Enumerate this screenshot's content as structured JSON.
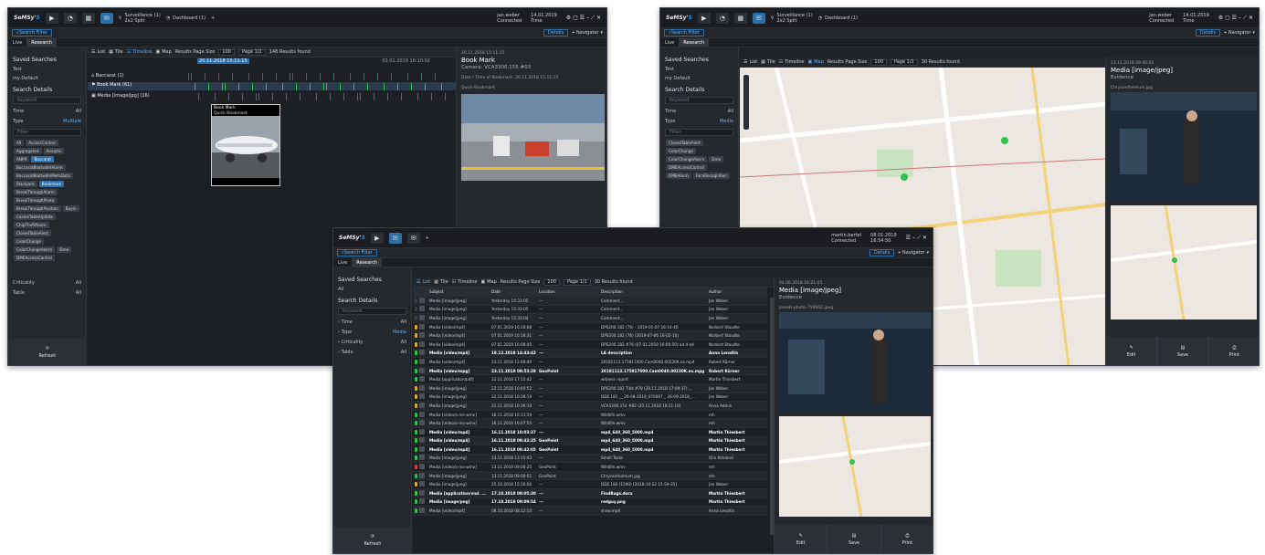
{
  "brand": {
    "name": "SeMSy",
    "suffix": "S"
  },
  "win1": {
    "tabs": [
      "Surveillance (1)",
      "2x2 Split",
      "Dashboard (1)"
    ],
    "user": "jan.weber",
    "status": "Connected",
    "date": "14.01.2019",
    "time": "Time",
    "search_filter": "Search Filter",
    "details": "Details",
    "navigator": "Navigator",
    "live": "Live",
    "research": "Research",
    "saved_searches": "Saved Searches",
    "saved": [
      "Test",
      "my Default"
    ],
    "search_details": "Search Details",
    "keyword": "Keyword",
    "time_val": "All",
    "type": "Type",
    "type_val": "Multiple",
    "filter": "Filter",
    "chips": [
      "All",
      "AccessControl",
      "Aggregated",
      "Analytic",
      "ANPR",
      "Baccarat",
      "BaccaratBlattwählAlarm",
      "BaccaratBlattwählMetaData",
      "Blackjack",
      "Bookmark",
      "BreakThroughAlarm",
      "BreakThroughPhoto",
      "BreakThroughPosition",
      "Buyin",
      "CasinoTableUpdate",
      "ChipTheftAlarm",
      "ClosedTableAlert",
      "ColorChange",
      "ColorChangeAlarm",
      "Dme",
      "DMEAccessControl"
    ],
    "criticality": "Criticality",
    "crit_val": "All",
    "table": "Table",
    "table_val": "All",
    "refresh": "Refresh",
    "toolbar": {
      "list": "List",
      "tile": "Tile",
      "timeline": "Timeline",
      "map": "Map",
      "page_size_lbl": "Results Page Size",
      "page_size": "100",
      "page": "Page 1/2",
      "results": "148 Results found"
    },
    "tl_date": "20.11.2018 15:11:15",
    "tl_right": "03.01.2019 16:10:02",
    "rows": [
      "Baccarat (1)",
      "Book Mark (61)",
      "Media [image/jpg] (16)"
    ],
    "popup": {
      "title": "Book Mark",
      "sub": "Quick Bookmark"
    },
    "detail": {
      "date": "20.11.2018 15:11:15",
      "title": "Book Mark",
      "sub": "Camera: VCA3300.155 #03",
      "line1": "Date / Time of Bookmark: 20.11.2018 15:11:15",
      "line2": "Quick Bookmark"
    }
  },
  "win2": {
    "tabs": [
      "Surveillance (1)",
      "2x2 Split",
      "Dashboard (1)"
    ],
    "user": "jan.weber",
    "status": "Connected",
    "date": "14.01.2019",
    "time": "Time",
    "search_filter": "Search Filter",
    "details": "Details",
    "navigator": "Navigator",
    "live": "Live",
    "research": "Research",
    "saved_searches": "Saved Searches",
    "saved": [
      "Test",
      "my Default"
    ],
    "search_details": "Search Details",
    "keyword": "Keyword",
    "time_val": "All",
    "type": "Type",
    "type_val": "Media",
    "filter": "Filter",
    "chips": [
      "ClosedTableAlert",
      "ColorChange",
      "ColorChangeAlarm",
      "Dme",
      "DMEAccessControl",
      "DMEAlarm",
      "FaceRecognition"
    ],
    "toolbar": {
      "list": "List",
      "tile": "Tile",
      "timeline": "Timeline",
      "map": "Map",
      "page_size_lbl": "Results Page Size",
      "page_size": "100",
      "page": "Page 1/1",
      "results": "30 Results found"
    },
    "detail": {
      "date": "13.11.2018 09:00:01",
      "title": "Media [image/jpeg]",
      "sub": "Evidence",
      "file": "Chrysanthemum.jpg"
    },
    "actions": [
      "Edit",
      "Save",
      "Print"
    ]
  },
  "win3": {
    "user": "martin.bertel",
    "status": "Connected",
    "date": "08.01.2019",
    "time": "16:54:50",
    "search_filter": "Search Filter",
    "details": "Details",
    "navigator": "Navigator",
    "live": "Live",
    "research": "Research",
    "saved_searches": "Saved Searches",
    "saved": [
      "All"
    ],
    "search_details": "Search Details",
    "keyword": "Keyword",
    "filters": [
      [
        "Time",
        "All"
      ],
      [
        "Type",
        "Media"
      ],
      [
        "Criticality",
        "All"
      ],
      [
        "Table",
        "All"
      ]
    ],
    "refresh": "Refresh",
    "toolbar": {
      "list": "List",
      "tile": "Tile",
      "timeline": "Timeline",
      "map": "Map",
      "page_size_lbl": "Results Page Size",
      "page_size": "100",
      "page": "Page 1/1",
      "results": "30 Results found"
    },
    "columns": [
      "Subject",
      "Date",
      "Location",
      "Description",
      "Author"
    ],
    "rows": [
      {
        "s": "Media [image/jpeg]",
        "d": "Yesterday 15:33:05",
        "l": "---",
        "desc": "Comment...",
        "a": "Jan Weber",
        "c": "#3a3f45",
        "b": false
      },
      {
        "s": "Media [image/jpeg]",
        "d": "Yesterday 15:33:05",
        "l": "---",
        "desc": "Comment...",
        "a": "Jan Weber",
        "c": "#3a3f45",
        "b": false
      },
      {
        "s": "Media [image/jpeg]",
        "d": "Yesterday 15:33:04",
        "l": "---",
        "desc": "Comment...",
        "a": "Jan Weber",
        "c": "#3a3f45",
        "b": false
      },
      {
        "s": "Media [video/mp4]",
        "d": "07.01.2019 16:18:08",
        "l": "---",
        "desc": "DPS200.182 (76) - 2019-01-07 16-14-40",
        "a": "Norbert Staudte",
        "c": "#d9a72a",
        "b": false
      },
      {
        "s": "Media [video/mp4]",
        "d": "07.01.2019 16:18:31",
        "l": "---",
        "desc": "DPS200.182 (76) (2019-07-06 16-02-10)",
        "a": "Norbert Staudte",
        "c": "#d9a72a",
        "b": false
      },
      {
        "s": "Media [video/mp4]",
        "d": "07.01.2019 16:08:45",
        "l": "---",
        "desc": "DPS200.182.#76 (07.01.2019 16:00:50) ad d ed",
        "a": "Norbert Staudte",
        "c": "#d9a72a",
        "b": false
      },
      {
        "s": "Media [video/mp4]",
        "d": "18.12.2018 14:43:42",
        "l": "---",
        "desc": "LA description",
        "a": "Anna Lenaltis",
        "c": "#2ec24a",
        "b": true
      },
      {
        "s": "Media [video/mp4]",
        "d": "23.11.2018 12:48:40",
        "l": "---",
        "desc": "20181113.175817000.Cam0040.00230K.ex.mp4",
        "a": "Robert Körner",
        "c": "#2ec24a",
        "b": false
      },
      {
        "s": "Media [video/mpg]",
        "d": "23.11.2018 09:53:28",
        "l": "GeoPoint",
        "desc": "20181113.175817000.Cam0040.00230K.ex.mpg",
        "a": "Robert Körner",
        "c": "#2ec24a",
        "b": true
      },
      {
        "s": "Media [application/pdf]",
        "d": "22.11.2018 17:15:42",
        "l": "---",
        "desc": "witness report",
        "a": "Martin Thiesbert",
        "c": "#2ec24a",
        "b": false
      },
      {
        "s": "Media [image/jpeg]",
        "d": "22.11.2018 10:40:52",
        "l": "---",
        "desc": "DPS200.182 Tilst.#78 (20.11.2018 17:09:37) ...",
        "a": "Jan Weber",
        "c": "#d9a72a",
        "b": false
      },
      {
        "s": "Media [image/jpeg]",
        "d": "22.11.2018 10:38:19",
        "l": "---",
        "desc": "DDE.181 __ 20-08-2018_070607 _ 26-09-2018_...",
        "a": "Jan Weber",
        "c": "#d9a72a",
        "b": false
      },
      {
        "s": "Media [image/jpeg]",
        "d": "21.11.2018 10:36:10",
        "l": "---",
        "desc": "VCA3200.154 #82 (20.11.2018 16:21:16)",
        "a": "Anna Admin",
        "c": "#d9a72a",
        "b": false
      },
      {
        "s": "Media [video/x-ms-wmv]",
        "d": "16.11.2018 16:11:59",
        "l": "---",
        "desc": "Wildlife.wmv",
        "a": "mh",
        "c": "#2ec24a",
        "b": false
      },
      {
        "s": "Media [video/x-ms-wmv]",
        "d": "16.11.2018 16:07:55",
        "l": "---",
        "desc": "Wildlife.wmv",
        "a": "mh",
        "c": "#2ec24a",
        "b": false
      },
      {
        "s": "Media [video/mp4]",
        "d": "16.11.2018 10:03:37",
        "l": "---",
        "desc": "mp4_640_360_5000.mp4",
        "a": "Martin Thiesbert",
        "c": "#2ec24a",
        "b": true
      },
      {
        "s": "Media [video/mp4]",
        "d": "16.11.2018 09:42:35",
        "l": "GeoPoint",
        "desc": "mp4_640_360_5000.mp4",
        "a": "Martin Thiesbert",
        "c": "#2ec24a",
        "b": true
      },
      {
        "s": "Media [video/mp4]",
        "d": "16.11.2018 09:42:05",
        "l": "GeoPoint",
        "desc": "mp4_640_360_5000.mp4",
        "a": "Martin Thiesbert",
        "c": "#2ec24a",
        "b": true
      },
      {
        "s": "Media [image/jpeg]",
        "d": "13.11.2018 13:15:43",
        "l": "---",
        "desc": "Small Tasks",
        "a": "Olin Kirkland",
        "c": "#2ec24a",
        "b": false
      },
      {
        "s": "Media [video/x-ms-wmv]",
        "d": "13.11.2018 09:00:25",
        "l": "GeoPoint",
        "desc": "Wildlife.wmv",
        "a": "mh",
        "c": "#e03a3a",
        "b": false
      },
      {
        "s": "Media [image/jpeg]",
        "d": "13.11.2018 09:00:01",
        "l": "GeoPoint",
        "desc": "Chrysanthemum.jpg",
        "a": "mh",
        "c": "#2ec24a",
        "b": false
      },
      {
        "s": "Media [image/jpeg]",
        "d": "25.10.2018 15:16:06",
        "l": "---",
        "desc": "DDE.180 (1590) [2018-10-22 15-59-35]",
        "a": "Jan Weber",
        "c": "#d9a72a",
        "b": false
      },
      {
        "s": "Media [application/vnd. ...",
        "d": "17.10.2018 09:05:30",
        "l": "---",
        "desc": "FindBugs.docx",
        "a": "Martin Thiesbert",
        "c": "#2ec24a",
        "b": true
      },
      {
        "s": "Media [image/png]",
        "d": "17.10.2018 09:09:54",
        "l": "---",
        "desc": "redguy.png",
        "a": "Martin Thiesbert",
        "c": "#2ec24a",
        "b": true
      },
      {
        "s": "Media [video/mp4]",
        "d": "08.10.2018 08:12:15",
        "l": "---",
        "desc": "show.mp4",
        "a": "Anna Lenaltis",
        "c": "#2ec24a",
        "b": false
      }
    ],
    "detail": {
      "date": "04.06.2018 16:21:05",
      "title": "Media [image/jpeg]",
      "sub": "Evidence",
      "file": "pexels-photo-756662.jpeg"
    },
    "actions": [
      "Edit",
      "Save",
      "Print"
    ]
  }
}
